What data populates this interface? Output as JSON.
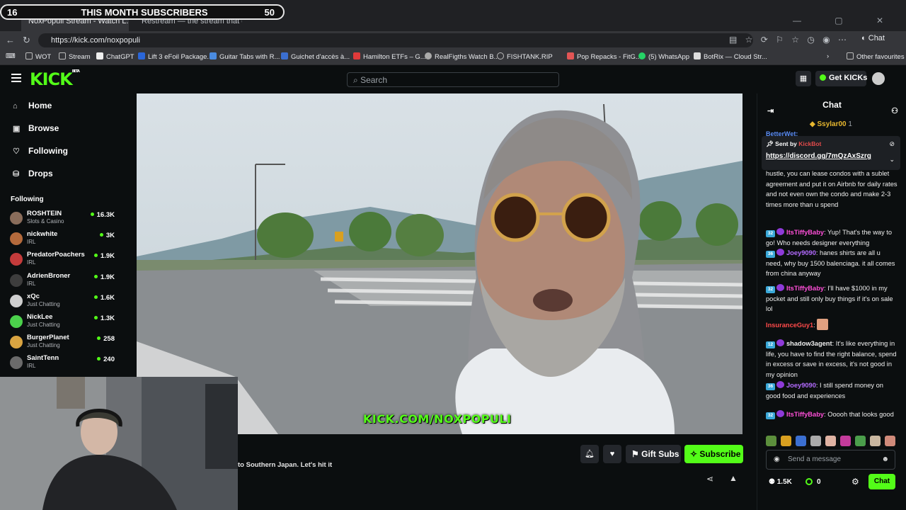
{
  "overlay": {
    "left_num": "16",
    "title": "THIS MONTH SUBSCRIBERS",
    "right_num": "50"
  },
  "browser": {
    "tabs": [
      "NoxPopuli Stream - Watch L...",
      "Restream — the stream that doe..."
    ],
    "url": "https://kick.com/noxpopuli",
    "chat_ext_label": "Chat",
    "bookmarks": [
      "WOT",
      "Stream",
      "ChatGPT",
      "Lift 3 eFoil Package...",
      "Guitar Tabs with R...",
      "Guichet d'accès à...",
      "Hamilton ETFs – G...",
      "RealFigths Watch B...",
      "FISHTANK.RIP",
      "Pop Repacks - FitG...",
      "(5) WhatsApp",
      "BotRix — Cloud Str...",
      "Other favourites"
    ]
  },
  "header": {
    "logo": "KICK",
    "logo_tag": "BETA",
    "search_placeholder": "Search",
    "get_kicks": "Get KICKs"
  },
  "sidebar": {
    "nav": [
      {
        "label": "Home",
        "icon": "home-icon"
      },
      {
        "label": "Browse",
        "icon": "browse-icon"
      },
      {
        "label": "Following",
        "icon": "heart-icon"
      },
      {
        "label": "Drops",
        "icon": "drops-icon"
      }
    ],
    "following_title": "Following",
    "following": [
      {
        "name": "ROSHTEIN",
        "category": "Slots & Casino",
        "viewers": "16.3K",
        "color": "#8a6d5b"
      },
      {
        "name": "nickwhite",
        "category": "IRL",
        "viewers": "3K",
        "color": "#b46a3c"
      },
      {
        "name": "PredatorPoachers",
        "category": "IRL",
        "viewers": "1.9K",
        "color": "#c43b3b"
      },
      {
        "name": "AdrienBroner",
        "category": "IRL",
        "viewers": "1.9K",
        "color": "#3d3d3d"
      },
      {
        "name": "xQc",
        "category": "Just Chatting",
        "viewers": "1.6K",
        "color": "#cfcfcf"
      },
      {
        "name": "NickLee",
        "category": "Just Chatting",
        "viewers": "1.3K",
        "color": "#4bd14b"
      },
      {
        "name": "BurgerPlanet",
        "category": "Just Chatting",
        "viewers": "258",
        "color": "#d9a441"
      },
      {
        "name": "SaintTenn",
        "category": "IRL",
        "viewers": "240",
        "color": "#6b6b6b"
      }
    ]
  },
  "video": {
    "overlay_url": "KICK.COM/NOXPOPULI"
  },
  "stream": {
    "title": "to Southern Japan. Let's hit it",
    "gift_subs": "Gift Subs",
    "subscribe": "Subscribe"
  },
  "chat": {
    "title": "Chat",
    "pinned_user": "Ssylar00",
    "pinned_user_num": "1",
    "partial_name": "BetterWet:",
    "pinned_sent_by": "Sent by",
    "pinned_bot": "KickBot",
    "pinned_link": "https://discord.gg/7mQzAxSzrg",
    "messages": [
      {
        "badge": "",
        "user": "",
        "color": "#efefef",
        "text": "hustle, you can lease condos with a sublet agreement and put it on Airbnb for daily rates and not even own the condo and make 2-3 times more than u spend"
      },
      {
        "badge": "32",
        "user": "ItsTiffyBaby",
        "color": "#ff4fd8",
        "text": "Yup! That's the way to go! Who needs designer everything"
      },
      {
        "badge": "36",
        "user": "Joey9090",
        "color": "#b36bff",
        "text": "hanes shirts are all u need, why buy 1500 balenciaga. it all comes from china anyway"
      },
      {
        "badge": "32",
        "user": "ItsTiffyBaby",
        "color": "#ff4fd8",
        "text": "I'll have $1000 in my pocket and still only buy things if it's on sale lol"
      },
      {
        "badge": "",
        "user": "InsuranceGuy1",
        "color": "#ff4a4a",
        "text": ""
      },
      {
        "badge": "12",
        "user": "shadow3agent",
        "color": "#efefef",
        "text": "It's like everything in life, you have to find the right balance, spend in excess or save in excess, it's not good in my opinion"
      },
      {
        "badge": "36",
        "user": "Joey9090",
        "color": "#b36bff",
        "text": "I still spend money on good food and experiences"
      },
      {
        "badge": "32",
        "user": "ItsTiffyBaby",
        "color": "#ff4fd8",
        "text": "Ooooh that looks good"
      }
    ],
    "input_placeholder": "Send a message",
    "viewers": "1.5K",
    "kicks": "0",
    "send_label": "Chat"
  }
}
